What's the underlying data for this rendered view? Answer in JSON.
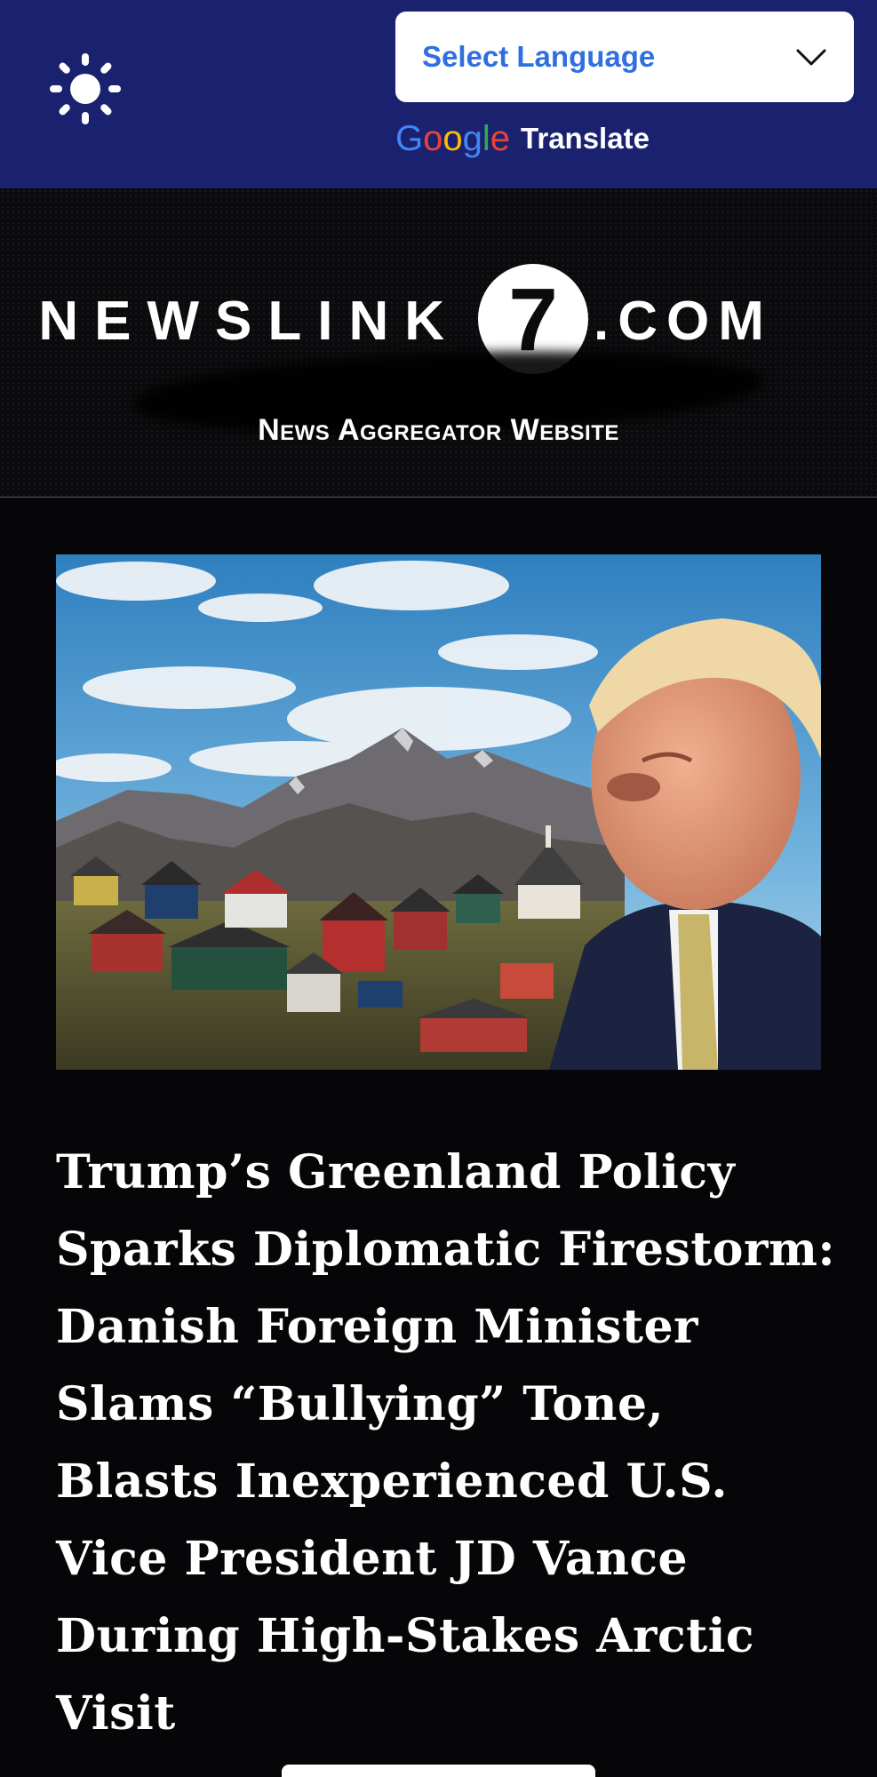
{
  "header": {
    "theme_toggle_icon": "sun-icon",
    "language_select": {
      "label": "Select Language",
      "icon": "chevron-down-icon"
    },
    "translate_brand": {
      "google_letters": [
        "G",
        "o",
        "o",
        "g",
        "l",
        "e"
      ],
      "google_colors": [
        "#4285F4",
        "#EA4335",
        "#FBBC05",
        "#4285F4",
        "#34A853",
        "#EA4335"
      ],
      "label": "Translate"
    }
  },
  "brand": {
    "name_left": "NEWSLINK",
    "logo_digit": "7",
    "name_right": ".COM",
    "tagline": "News Aggregator Website"
  },
  "article": {
    "image_icon": "greenland-trump-photo",
    "headline": "Trump’s Greenland Policy Sparks Diplomatic Firestorm: Danish Foreign Minister Slams “Bullying” Tone, Blasts Inexperienced U.S. Vice President JD Vance During High-Stakes Arctic Visit"
  },
  "colors": {
    "topbar": "#1a2270",
    "background": "#060608",
    "select_text": "#2f6fe0"
  }
}
